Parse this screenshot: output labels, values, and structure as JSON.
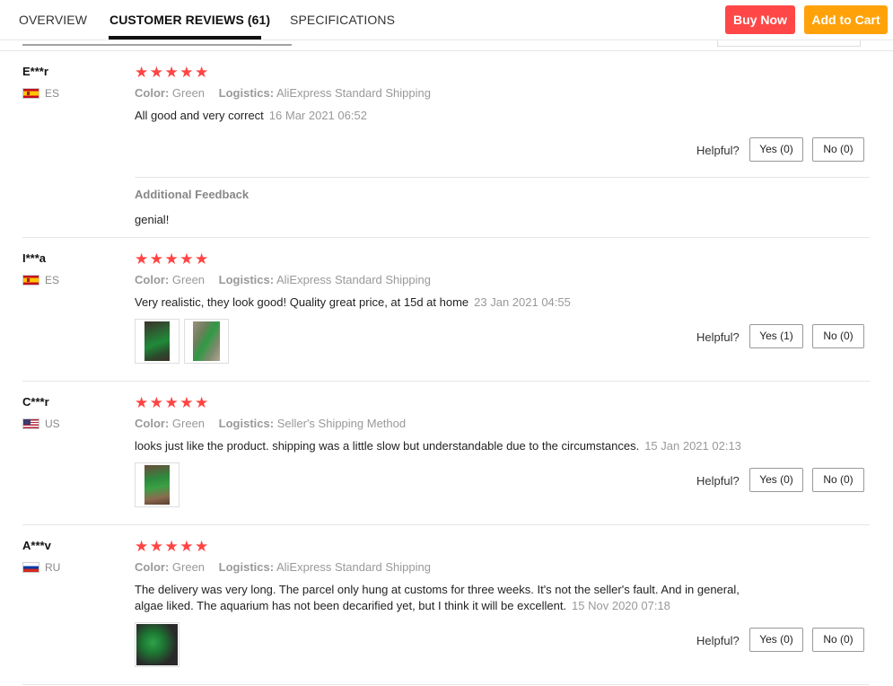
{
  "tabs": {
    "overview": "OVERVIEW",
    "reviews": "CUSTOMER REVIEWS (61)",
    "specs": "SPECIFICATIONS"
  },
  "actions": {
    "buy_now": "Buy Now",
    "add_to_cart": "Add to Cart"
  },
  "colors": {
    "buy_now": "#ff4747",
    "add_to_cart": "#ffa20a",
    "stars": "#ff4444"
  },
  "labels": {
    "color": "Color:",
    "logistics": "Logistics:",
    "helpful": "Helpful?",
    "additional_feedback": "Additional Feedback"
  },
  "reviews": [
    {
      "user": "E***r",
      "country": "ES",
      "flag_icon": "spain-flag-icon",
      "rating": 5,
      "stars": "★★★★★",
      "color": "Green",
      "logistics": "AliExpress Standard Shipping",
      "text": "All good and very correct",
      "date": "16 Mar 2021 06:52",
      "yes": "Yes (0)",
      "no": "No (0)",
      "additional_feedback": "genial!"
    },
    {
      "user": "I***a",
      "country": "ES",
      "flag_icon": "spain-flag-icon",
      "rating": 5,
      "stars": "★★★★★",
      "color": "Green",
      "logistics": "AliExpress Standard Shipping",
      "text": "Very realistic, they look good! Quality great price, at 15d at home",
      "date": "23 Jan 2021 04:55",
      "yes": "Yes (1)",
      "no": "No (0)",
      "photos": 2
    },
    {
      "user": "C***r",
      "country": "US",
      "flag_icon": "us-flag-icon",
      "rating": 5,
      "stars": "★★★★★",
      "color": "Green",
      "logistics": "Seller's Shipping Method",
      "text": "looks just like the product. shipping was a little slow but understandable due to the circumstances.",
      "date": "15 Jan 2021 02:13",
      "yes": "Yes (0)",
      "no": "No (0)",
      "photos": 1
    },
    {
      "user": "A***v",
      "country": "RU",
      "flag_icon": "russia-flag-icon",
      "rating": 5,
      "stars": "★★★★★",
      "color": "Green",
      "logistics": "AliExpress Standard Shipping",
      "text_line1": "The delivery was very long. The parcel only hung at customs for three weeks. It's not the seller's fault. And in general,",
      "text_line2": "algae liked. The aquarium has not been decarified yet, but I think it will be excellent.",
      "date": "15 Nov 2020 07:18",
      "yes": "Yes (0)",
      "no": "No (0)",
      "photos": 1
    }
  ]
}
